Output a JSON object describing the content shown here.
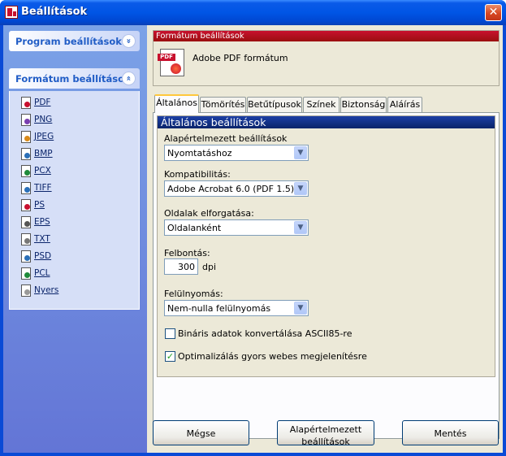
{
  "window": {
    "title": "Beállítások"
  },
  "sidebar": {
    "program_panel": {
      "title": "Program beállítások"
    },
    "format_panel": {
      "title": "Formátum beállítások",
      "items": [
        {
          "label": "PDF",
          "icon": "pdf-file-icon",
          "color": "#c8102e"
        },
        {
          "label": "PNG",
          "icon": "png-file-icon",
          "color": "#7a3fb0"
        },
        {
          "label": "JPEG",
          "icon": "jpeg-file-icon",
          "color": "#d98a1a"
        },
        {
          "label": "BMP",
          "icon": "bmp-file-icon",
          "color": "#2a6fb8"
        },
        {
          "label": "PCX",
          "icon": "pcx-file-icon",
          "color": "#1f8a3a"
        },
        {
          "label": "TIFF",
          "icon": "tiff-file-icon",
          "color": "#2a6fb8"
        },
        {
          "label": "PS",
          "icon": "ps-file-icon",
          "color": "#c8102e"
        },
        {
          "label": "EPS",
          "icon": "eps-file-icon",
          "color": "#555555"
        },
        {
          "label": "TXT",
          "icon": "txt-file-icon",
          "color": "#777777"
        },
        {
          "label": "PSD",
          "icon": "psd-file-icon",
          "color": "#2a6fb8"
        },
        {
          "label": "PCL",
          "icon": "pcl-file-icon",
          "color": "#1f8a3a"
        },
        {
          "label": "Nyers",
          "icon": "raw-file-icon",
          "color": "#999999"
        }
      ]
    }
  },
  "format_header": {
    "bar_title": "Formátum beállítások",
    "icon_tag": "PDF",
    "format_name": "Adobe PDF formátum"
  },
  "tabs": [
    {
      "label": "Általános"
    },
    {
      "label": "Tömörítés"
    },
    {
      "label": "Betűtípusok"
    },
    {
      "label": "Színek"
    },
    {
      "label": "Biztonság"
    },
    {
      "label": "Aláírás"
    }
  ],
  "general": {
    "group_title": "Általános beállítások",
    "preset_label": "Alapértelmezett beállítások",
    "preset_value": "Nyomtatáshoz",
    "compat_label": "Kompatibilitás:",
    "compat_value": "Adobe Acrobat 6.0 (PDF 1.5)",
    "rotate_label": "Oldalak elforgatása:",
    "rotate_value": "Oldalanként",
    "resolution_label": "Felbontás:",
    "resolution_value": "300",
    "resolution_unit": "dpi",
    "overprint_label": "Felülnyomás:",
    "overprint_value": "Nem-nulla felülnyomás",
    "ascii85_label": "Bináris adatok konvertálása ASCII85-re",
    "ascii85_checked": false,
    "optimize_label": "Optimalizálás gyors webes megjelenítésre",
    "optimize_checked": true,
    "check_mark": "✓"
  },
  "buttons": {
    "cancel": "Mégse",
    "defaults_line1": "Alapértelmezett",
    "defaults_line2": "beállítások",
    "save": "Mentés"
  },
  "glyphs": {
    "close": "✕",
    "chev_down": "»",
    "chev_up": "«",
    "arrow": "▼"
  }
}
